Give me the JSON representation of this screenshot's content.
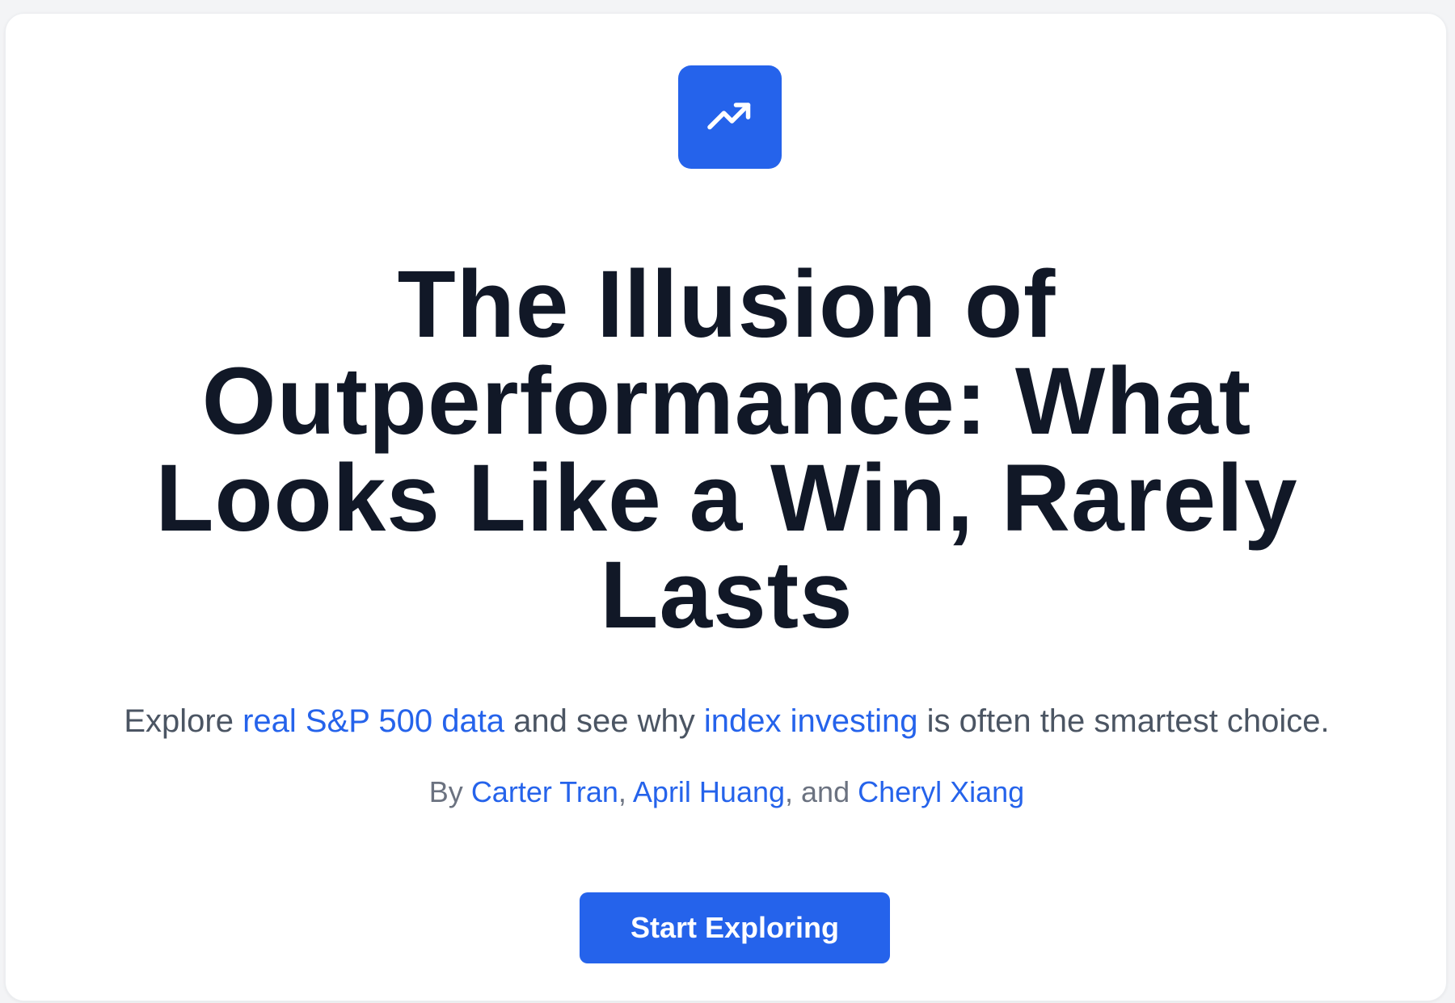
{
  "hero": {
    "icon": "trending-up-icon",
    "accent_color": "#2563eb",
    "title": "The Illusion of Outperformance: What Looks Like a Win, Rarely Lasts",
    "subtitle": {
      "part1": "Explore ",
      "link1": "real S&P 500 data",
      "part2": " and see why ",
      "link2": "index investing",
      "part3": " is often the smartest choice."
    },
    "byline": {
      "prefix": "By ",
      "author1": "Carter Tran",
      "sep1": ", ",
      "author2": "April Huang",
      "sep2": ", and ",
      "author3": "Cheryl Xiang"
    },
    "cta_label": "Start Exploring"
  }
}
